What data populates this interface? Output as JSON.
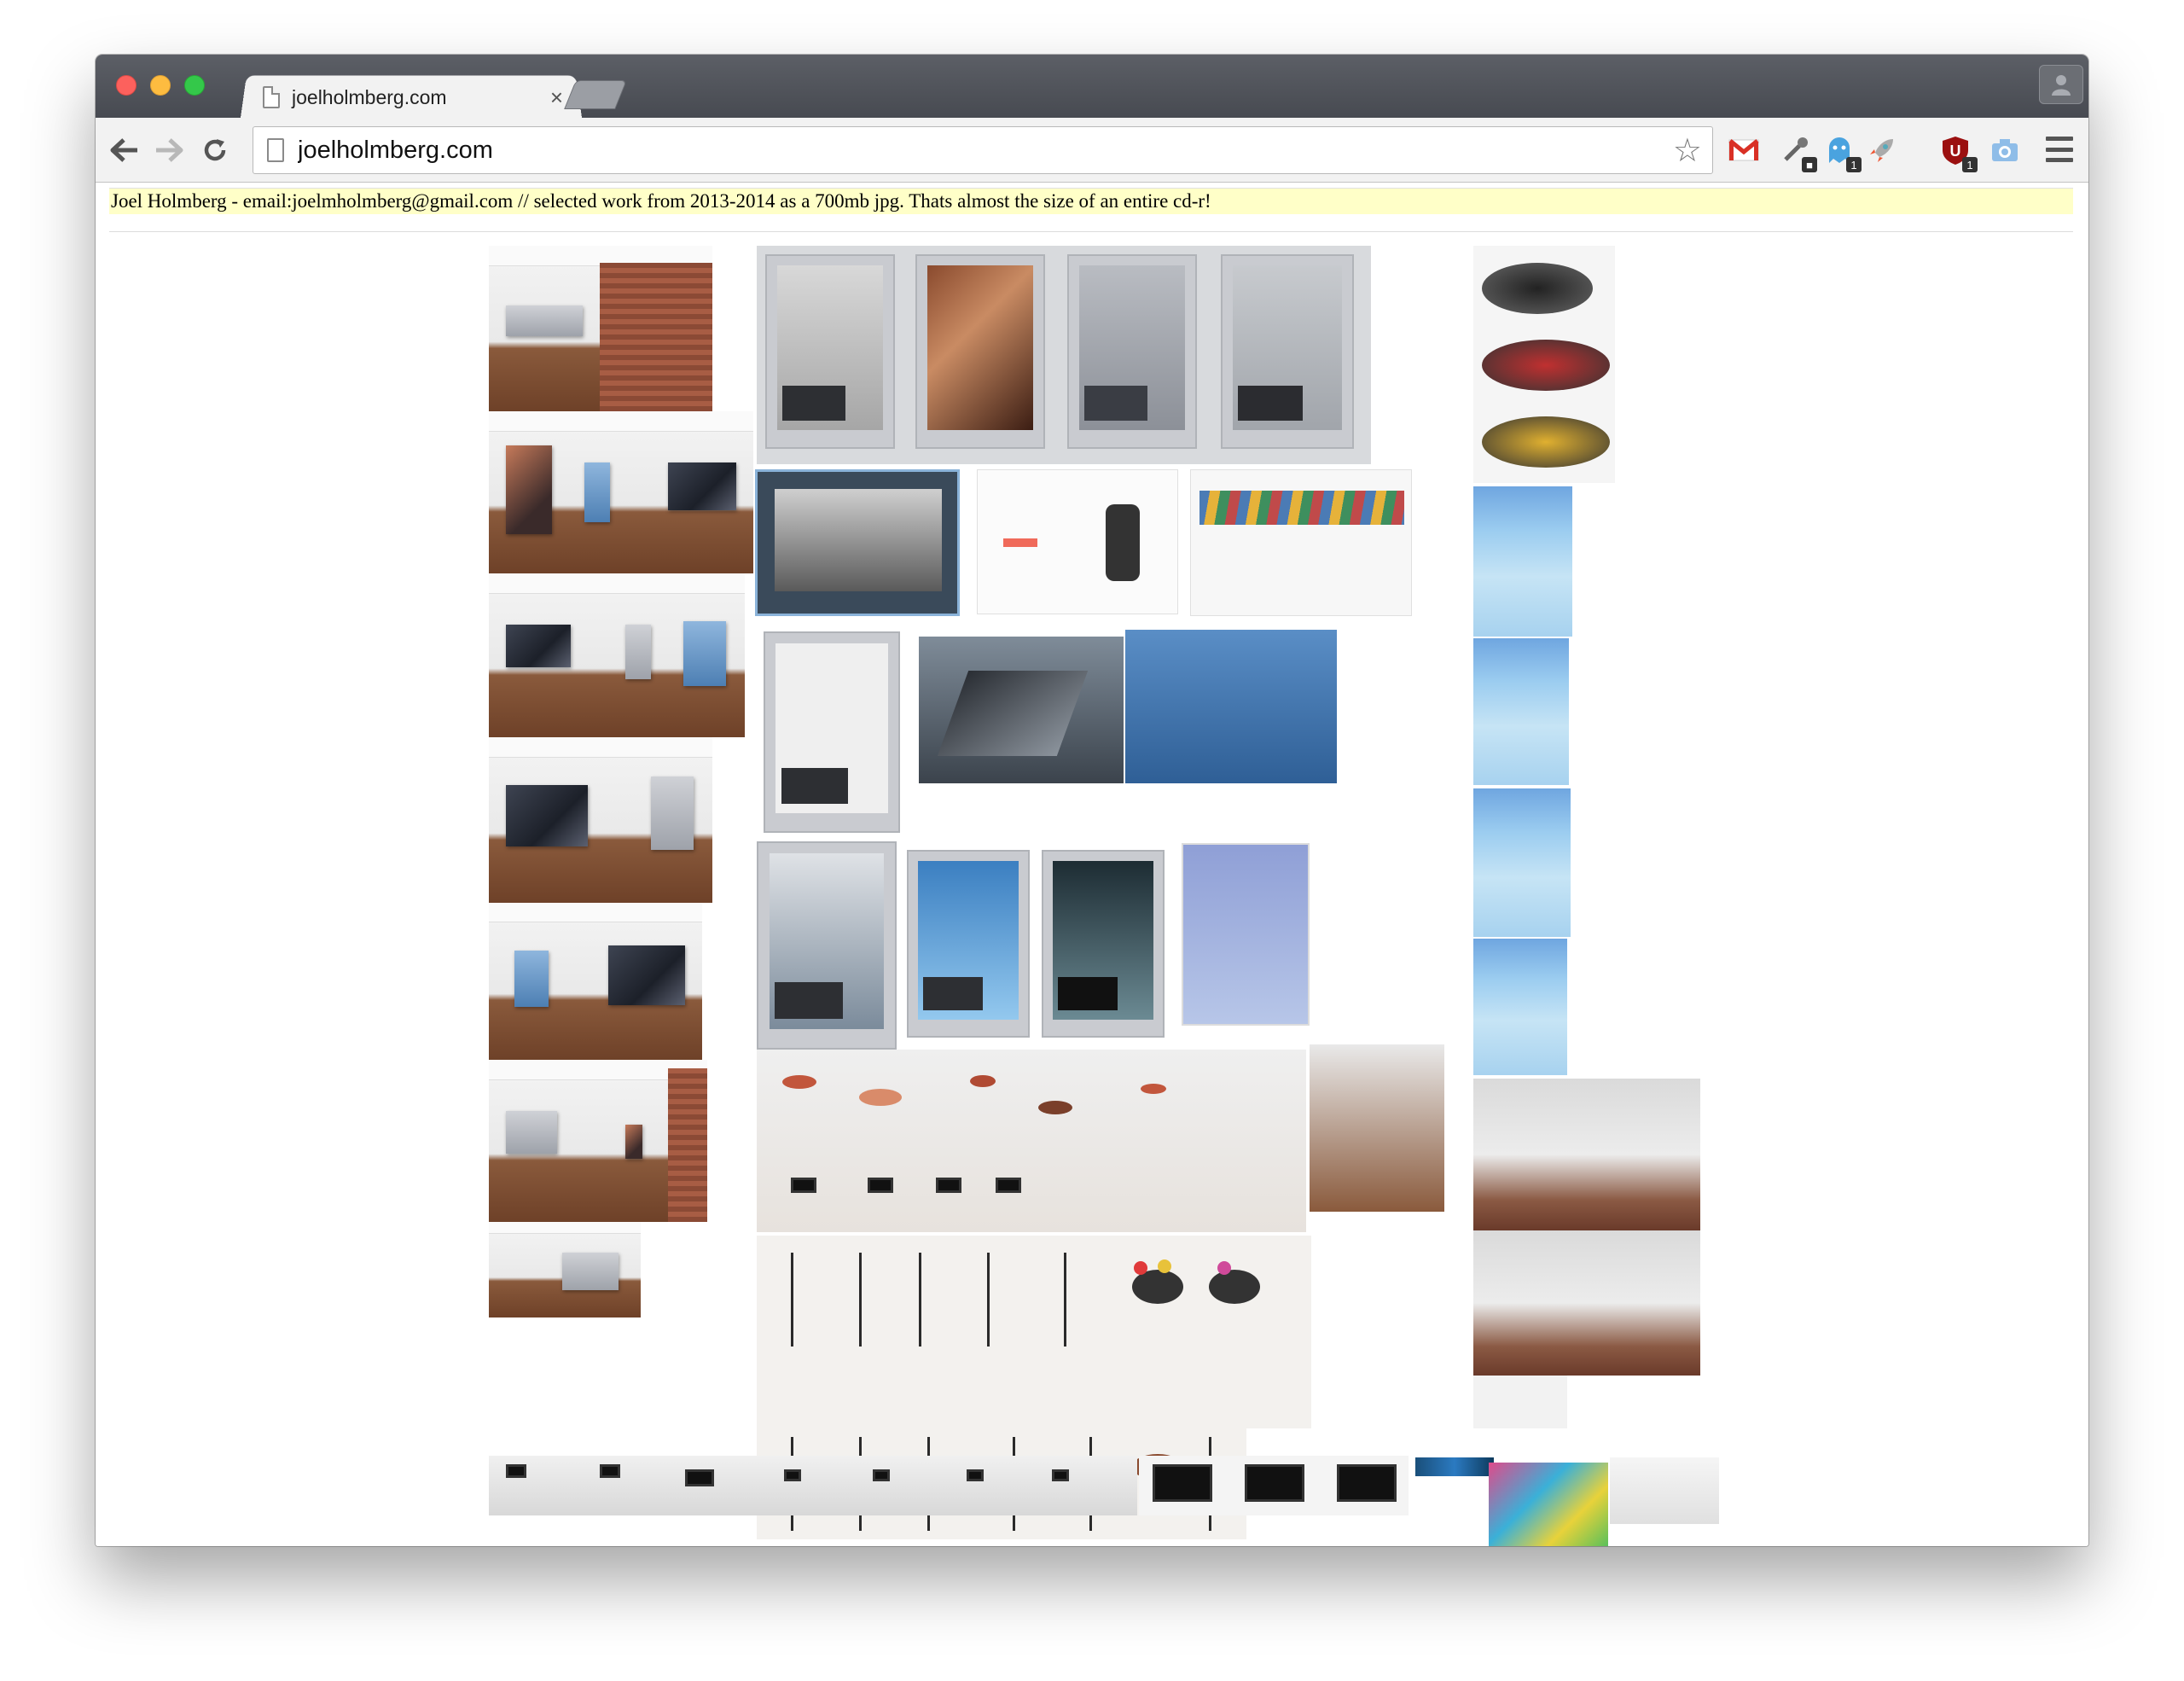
{
  "browser": {
    "tab_title": "joelholmberg.com",
    "tab_close": "×",
    "url": "joelholmberg.com",
    "star_icon": "☆",
    "extensions": [
      {
        "name": "gmail-icon",
        "glyph": "M",
        "color": "#d93025",
        "badge": ""
      },
      {
        "name": "eyedropper-icon",
        "glyph": "✒",
        "color": "#555555",
        "badge": ""
      },
      {
        "name": "ghostery-icon",
        "glyph": "☺",
        "color": "#4aa3df",
        "badge": "1"
      },
      {
        "name": "rocket-icon",
        "glyph": "🚀",
        "color": "#555555",
        "badge": ""
      },
      {
        "name": "ublock-icon",
        "glyph": "U",
        "color": "#9b1010",
        "badge": "1"
      },
      {
        "name": "camera-icon",
        "glyph": "◉",
        "color": "#6aa8e0",
        "badge": ""
      }
    ]
  },
  "page": {
    "header_text": "Joel Holmberg - email:joelmholmberg@gmail.com // selected work from 2013-2014 as a 700mb jpg. Thats almost the size of an entire cd-r!"
  },
  "colors": {
    "info_bar_bg": "#ffffc8",
    "titlebar": "#4f5258",
    "toolbar": "#f2f2f2"
  }
}
